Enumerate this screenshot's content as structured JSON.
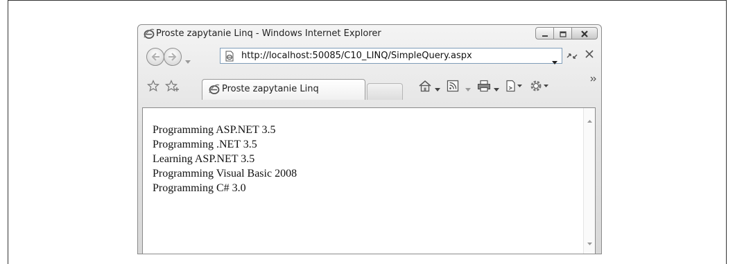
{
  "window": {
    "title": "Proste zapytanie Linq - Windows Internet Explorer"
  },
  "address_bar": {
    "url": "http://localhost:50085/C10_LINQ/SimpleQuery.aspx"
  },
  "tabs": [
    {
      "label": "Proste zapytanie Linq",
      "active": true
    }
  ],
  "page": {
    "lines": [
      "Programming ASP.NET 3.5",
      "Programming .NET 3.5",
      "Learning ASP.NET 3.5",
      "Programming Visual Basic 2008",
      "Programming C# 3.0"
    ]
  },
  "icons": {
    "title": "ie-logo-icon",
    "address": "page-icon",
    "tab": "ie-logo-icon",
    "favorites": "star-icon",
    "add_favorites": "add-favorites-icon",
    "home": "home-icon",
    "feeds": "feeds-icon",
    "print": "print-icon",
    "page_menu": "page-menu-icon",
    "tools": "tools-gear-icon"
  }
}
